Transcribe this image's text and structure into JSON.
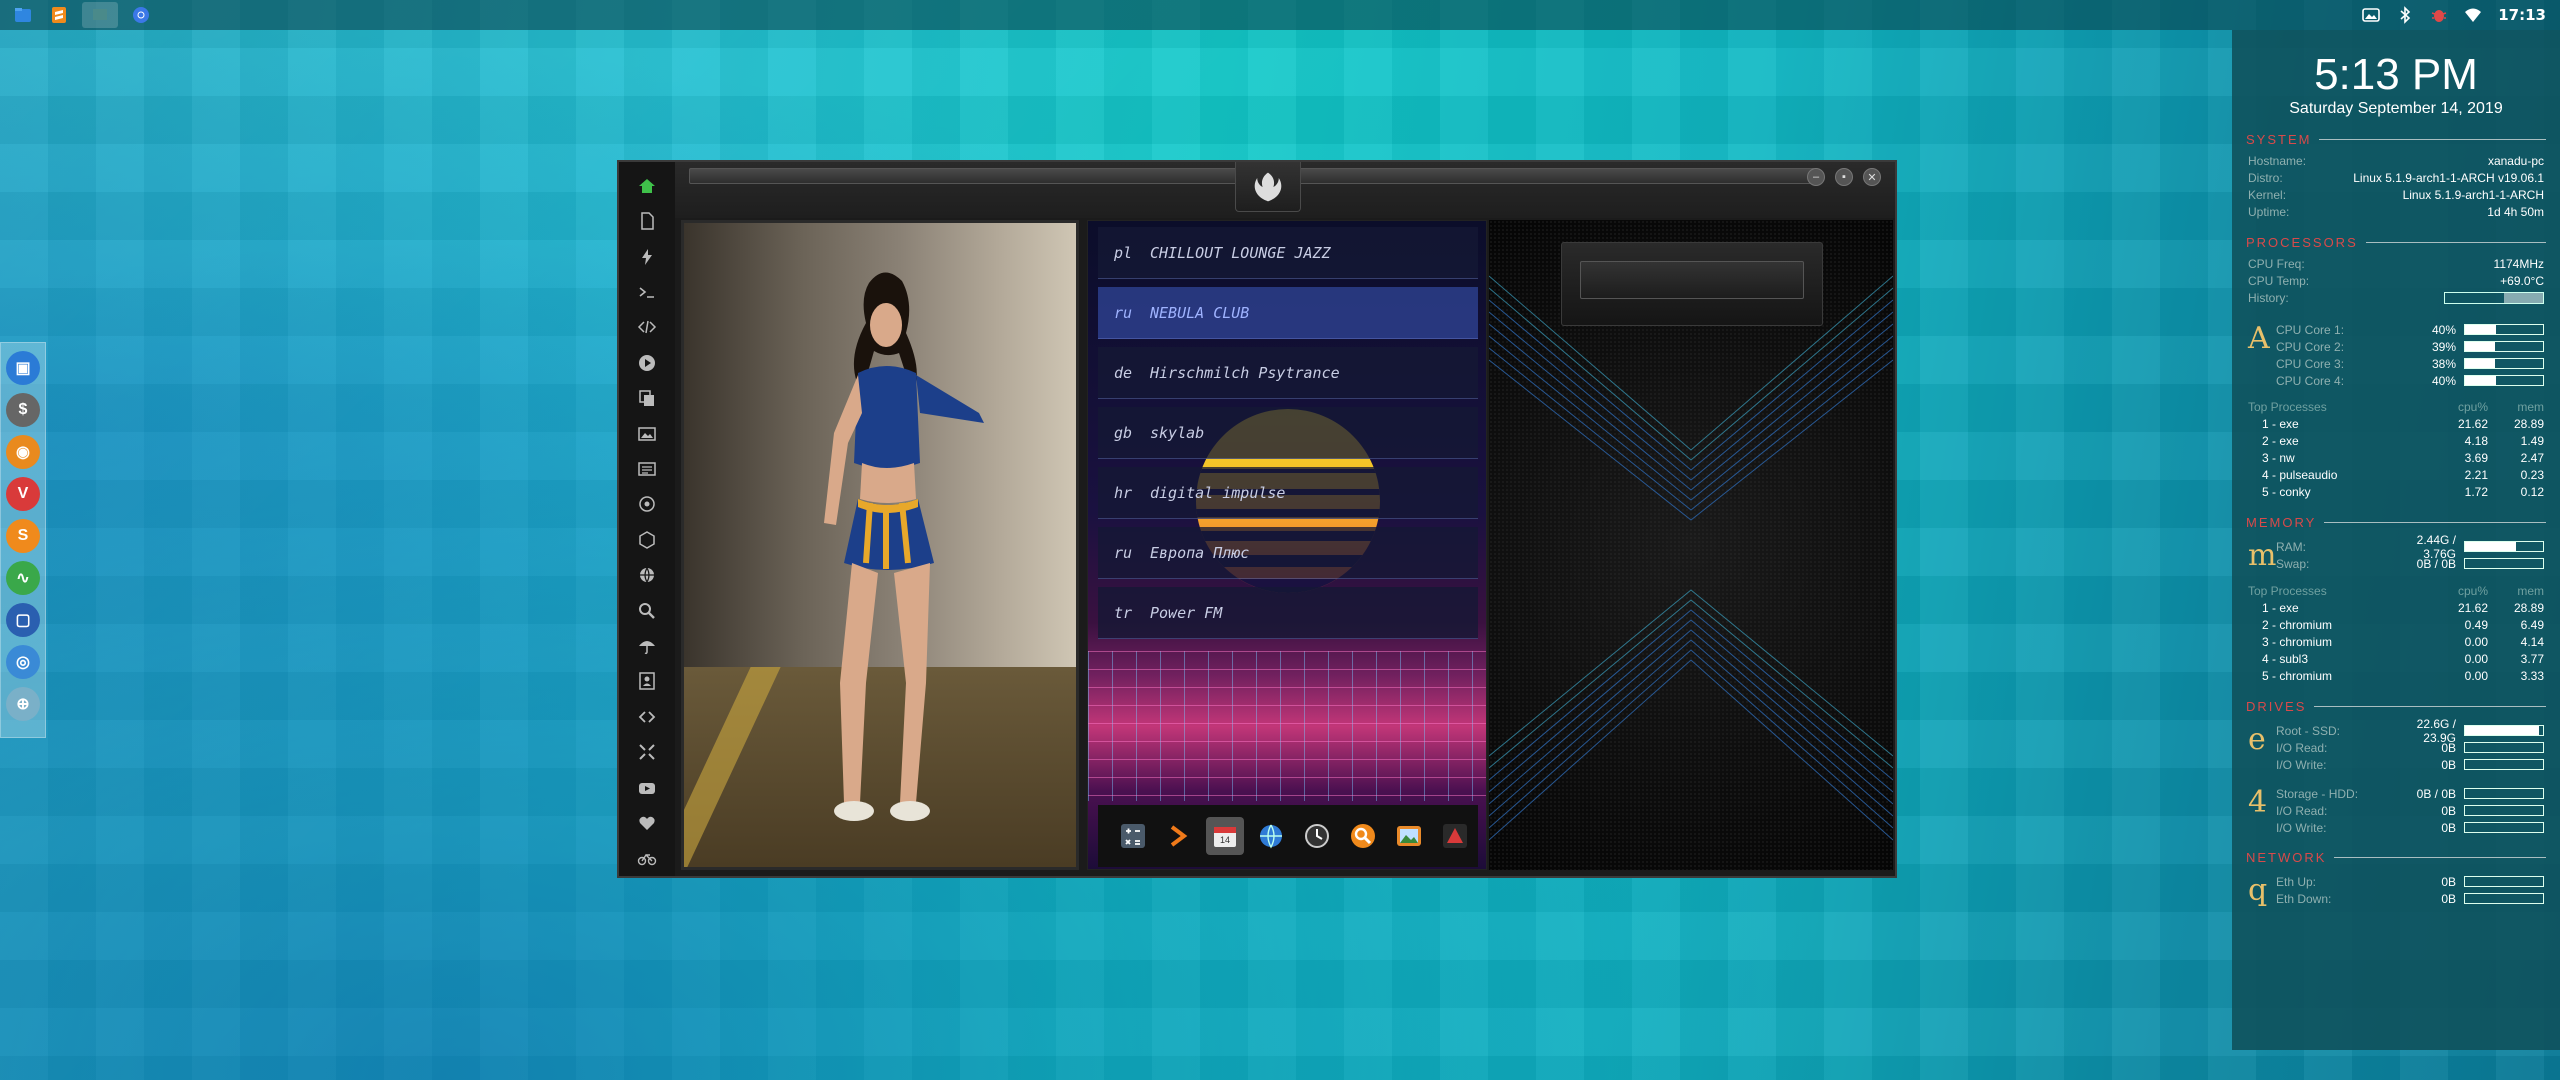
{
  "taskbar": {
    "apps": [
      "files-icon",
      "sublime-icon",
      "window-thumb-icon",
      "chrome-icon"
    ],
    "clock": "17:13"
  },
  "dock": {
    "items": [
      {
        "icon": "files-icon",
        "color": "#2b7bd6",
        "glyph": "▣"
      },
      {
        "icon": "money-icon",
        "color": "#666666",
        "glyph": "$"
      },
      {
        "icon": "ubuntu-icon",
        "color": "#e98a1e",
        "glyph": "◉"
      },
      {
        "icon": "vivaldi-icon",
        "color": "#d93a3a",
        "glyph": "V"
      },
      {
        "icon": "sublime-s-icon",
        "color": "#f08a1c",
        "glyph": "S"
      },
      {
        "icon": "pulse-icon",
        "color": "#3aa84a",
        "glyph": "∿"
      },
      {
        "icon": "screen-icon",
        "color": "#2a5fb0",
        "glyph": "▢"
      },
      {
        "icon": "chrome-icon",
        "color": "#3a8ad6",
        "glyph": "◎"
      },
      {
        "icon": "globe-icon",
        "color": "#7ab0c8",
        "glyph": "⊕"
      }
    ]
  },
  "radio": {
    "stations": [
      {
        "cc": "pl",
        "name": "CHILLOUT LOUNGE JAZZ"
      },
      {
        "cc": "ru",
        "name": "NEBULA CLUB"
      },
      {
        "cc": "de",
        "name": "Hirschmilch Psytrance"
      },
      {
        "cc": "gb",
        "name": "skylab"
      },
      {
        "cc": "hr",
        "name": "digital impulse"
      },
      {
        "cc": "ru",
        "name": "Европа Плюс"
      },
      {
        "cc": "tr",
        "name": "Power FM"
      }
    ],
    "selected_index": 1,
    "launcher": [
      "calculator-icon",
      "terminal-icon",
      "calendar-icon",
      "browser-globe-icon",
      "clock-icon",
      "search-icon",
      "image-viewer-icon",
      "pdf-icon"
    ]
  },
  "conky": {
    "time": "5:13 PM",
    "date": "Saturday September 14, 2019",
    "system": {
      "title": "SYSTEM",
      "rows": [
        {
          "k": "Hostname:",
          "v": "xanadu-pc"
        },
        {
          "k": "Distro:",
          "v": "Linux 5.1.9-arch1-1-ARCH v19.06.1"
        },
        {
          "k": "Kernel:",
          "v": "Linux 5.1.9-arch1-1-ARCH"
        },
        {
          "k": "Uptime:",
          "v": "1d 4h 50m"
        }
      ]
    },
    "processors": {
      "title": "PROCESSORS",
      "rows": [
        {
          "k": "CPU Freq:",
          "v": "1174MHz"
        },
        {
          "k": "CPU Temp:",
          "v": "+69.0°C"
        },
        {
          "k": "History:",
          "v": ""
        }
      ],
      "glyph": "A",
      "cores": [
        {
          "k": "CPU Core 1:",
          "v": "40%",
          "pct": 0.4
        },
        {
          "k": "CPU Core 2:",
          "v": "39%",
          "pct": 0.39
        },
        {
          "k": "CPU Core 3:",
          "v": "38%",
          "pct": 0.38
        },
        {
          "k": "CPU Core 4:",
          "v": "40%",
          "pct": 0.4
        }
      ],
      "top_head": {
        "name": "Top Processes",
        "cpu": "cpu%",
        "mem": "mem"
      },
      "top": [
        {
          "n": "1 - exe",
          "cpu": "21.62",
          "mem": "28.89"
        },
        {
          "n": "2 - exe",
          "cpu": "4.18",
          "mem": "1.49"
        },
        {
          "n": "3 - nw",
          "cpu": "3.69",
          "mem": "2.47"
        },
        {
          "n": "4 - pulseaudio",
          "cpu": "2.21",
          "mem": "0.23"
        },
        {
          "n": "5 - conky",
          "cpu": "1.72",
          "mem": "0.12"
        }
      ]
    },
    "memory": {
      "title": "MEMORY",
      "glyph": "m",
      "rows": [
        {
          "k": "RAM:",
          "v": "2.44G / 3.76G",
          "pct": 0.65
        },
        {
          "k": "Swap:",
          "v": "0B / 0B",
          "pct": 0
        }
      ],
      "top_head": {
        "name": "Top Processes",
        "cpu": "cpu%",
        "mem": "mem"
      },
      "top": [
        {
          "n": "1 - exe",
          "cpu": "21.62",
          "mem": "28.89"
        },
        {
          "n": "2 - chromium",
          "cpu": "0.49",
          "mem": "6.49"
        },
        {
          "n": "3 - chromium",
          "cpu": "0.00",
          "mem": "4.14"
        },
        {
          "n": "4 - subl3",
          "cpu": "0.00",
          "mem": "3.77"
        },
        {
          "n": "5 - chromium",
          "cpu": "0.00",
          "mem": "3.33"
        }
      ]
    },
    "drives": {
      "title": "DRIVES",
      "root": {
        "glyph": "e",
        "rows": [
          {
            "k": "Root - SSD:",
            "v": "22.6G / 23.9G",
            "pct": 0.95
          },
          {
            "k": "I/O Read:",
            "v": "0B",
            "pct": 0
          },
          {
            "k": "I/O Write:",
            "v": "0B",
            "pct": 0
          }
        ]
      },
      "storage": {
        "glyph": "4",
        "rows": [
          {
            "k": "Storage - HDD:",
            "v": "0B / 0B",
            "pct": 0
          },
          {
            "k": "I/O Read:",
            "v": "0B",
            "pct": 0
          },
          {
            "k": "I/O Write:",
            "v": "0B",
            "pct": 0
          }
        ]
      }
    },
    "network": {
      "title": "NETWORK",
      "glyph": "q",
      "rows": [
        {
          "k": "Eth Up:",
          "v": "0B",
          "pct": 0
        },
        {
          "k": "Eth Down:",
          "v": "0B",
          "pct": 0
        }
      ]
    }
  }
}
